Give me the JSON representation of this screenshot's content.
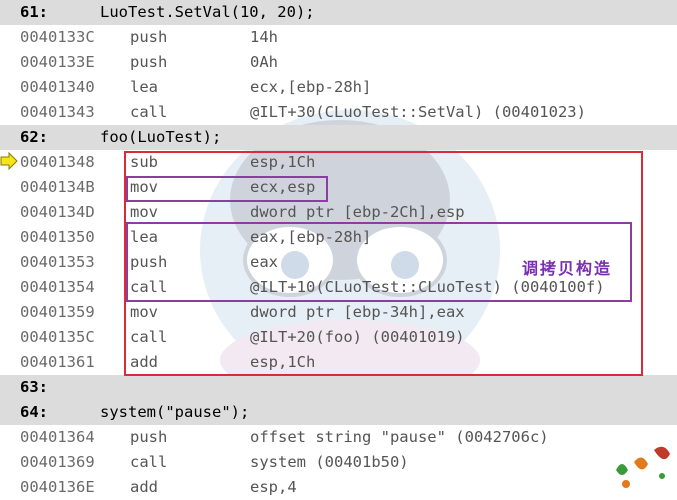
{
  "lines": [
    {
      "kind": "src",
      "num": "61:",
      "code": "LuoTest.SetVal(10, 20);"
    },
    {
      "kind": "asm",
      "addr": "0040133C",
      "mn": "push",
      "op": "14h"
    },
    {
      "kind": "asm",
      "addr": "0040133E",
      "mn": "push",
      "op": "0Ah"
    },
    {
      "kind": "asm",
      "addr": "00401340",
      "mn": "lea",
      "op": "ecx,[ebp-28h]"
    },
    {
      "kind": "asm",
      "addr": "00401343",
      "mn": "call",
      "op": "@ILT+30(CLuoTest::SetVal) (00401023)"
    },
    {
      "kind": "src",
      "num": "62:",
      "code": "foo(LuoTest);"
    },
    {
      "kind": "asm",
      "addr": "00401348",
      "mn": "sub",
      "op": "esp,1Ch"
    },
    {
      "kind": "asm",
      "addr": "0040134B",
      "mn": "mov",
      "op": "ecx,esp"
    },
    {
      "kind": "asm",
      "addr": "0040134D",
      "mn": "mov",
      "op": "dword ptr [ebp-2Ch],esp"
    },
    {
      "kind": "asm",
      "addr": "00401350",
      "mn": "lea",
      "op": "eax,[ebp-28h]"
    },
    {
      "kind": "asm",
      "addr": "00401353",
      "mn": "push",
      "op": "eax"
    },
    {
      "kind": "asm",
      "addr": "00401354",
      "mn": "call",
      "op": "@ILT+10(CLuoTest::CLuoTest) (0040100f)"
    },
    {
      "kind": "asm",
      "addr": "00401359",
      "mn": "mov",
      "op": "dword ptr [ebp-34h],eax"
    },
    {
      "kind": "asm",
      "addr": "0040135C",
      "mn": "call",
      "op": "@ILT+20(foo) (00401019)"
    },
    {
      "kind": "asm",
      "addr": "00401361",
      "mn": "add",
      "op": "esp,1Ch"
    },
    {
      "kind": "src",
      "num": "63:",
      "code": ""
    },
    {
      "kind": "src",
      "num": "64:",
      "code": "system(\"pause\");"
    },
    {
      "kind": "asm",
      "addr": "00401364",
      "mn": "push",
      "op": "offset string \"pause\" (0042706c)"
    },
    {
      "kind": "asm",
      "addr": "00401369",
      "mn": "call",
      "op": "system (00401b50)"
    },
    {
      "kind": "asm",
      "addr": "0040136E",
      "mn": "add",
      "op": "esp,4"
    }
  ],
  "annotation": {
    "text": "调拷贝构造"
  },
  "current_line_marker": "arrow-right-icon",
  "colors": {
    "highlight_box": "#d92b3a",
    "annotation_box": "#8a3fa0",
    "source_row_bg": "#dcdcdc"
  }
}
